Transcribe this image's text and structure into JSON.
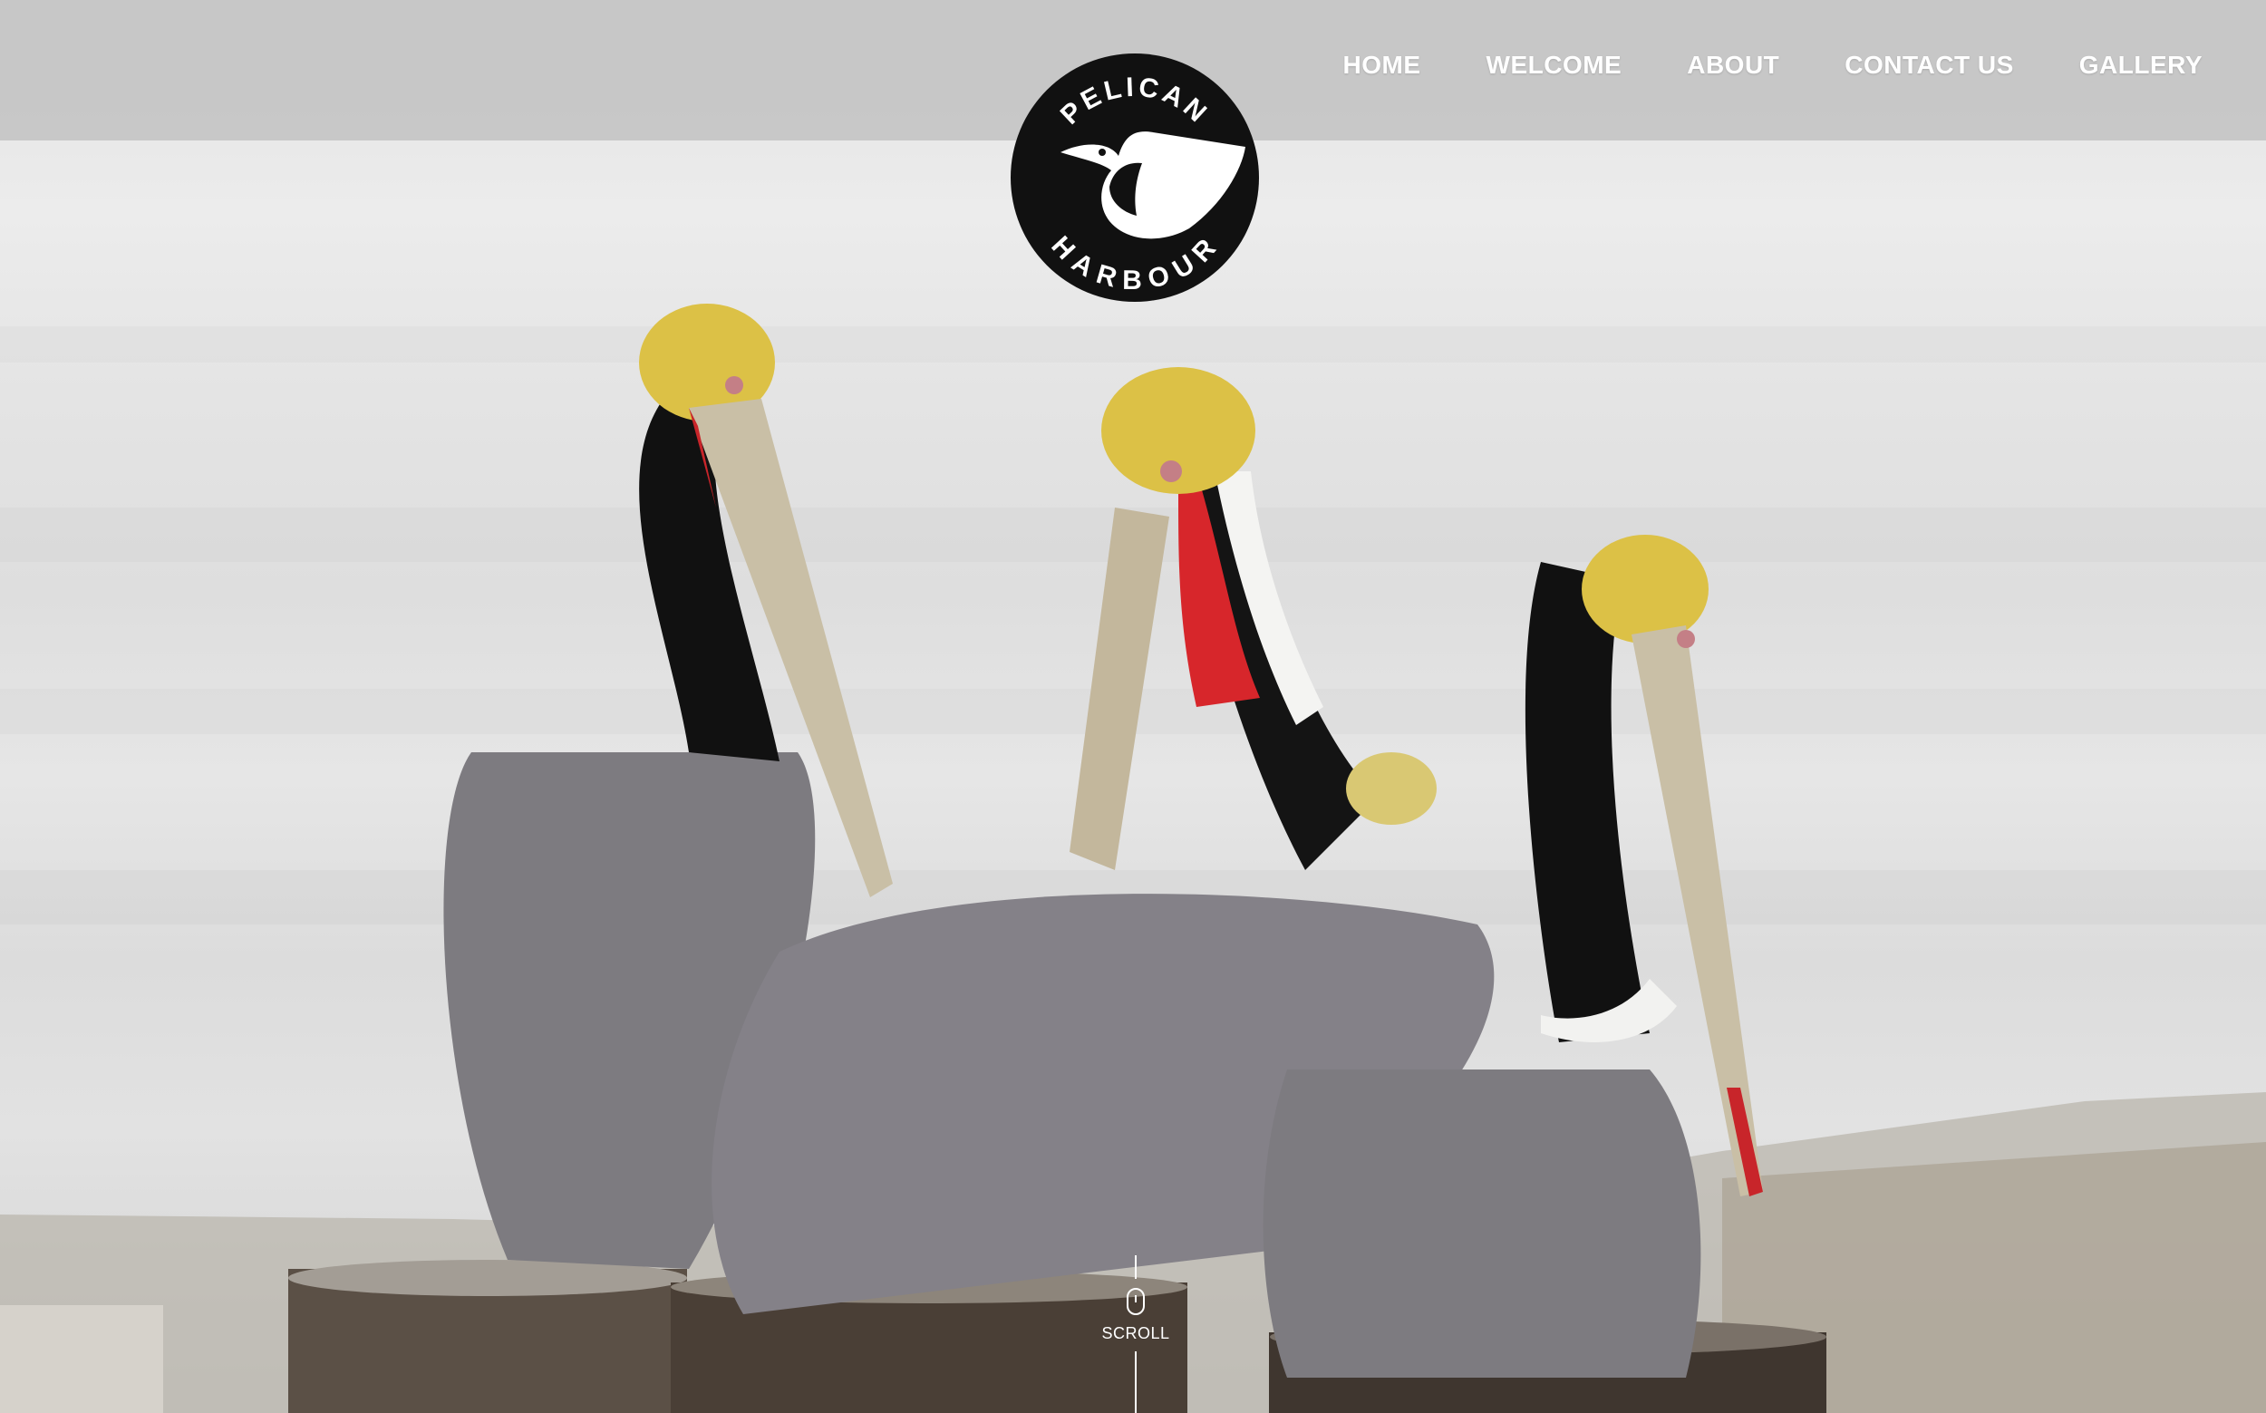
{
  "brand": {
    "logo_top": "PELICAN",
    "logo_bottom": "HARBOUR"
  },
  "nav": {
    "items": [
      {
        "label": "HOME"
      },
      {
        "label": "WELCOME"
      },
      {
        "label": "ABOUT"
      },
      {
        "label": "CONTACT US"
      },
      {
        "label": "GALLERY"
      }
    ]
  },
  "hero": {
    "scroll_label": "SCROLL"
  },
  "icons": [
    "pelican-logo-icon",
    "mouse-icon"
  ],
  "colors": {
    "header_bg": "#c4c4c4",
    "nav_text": "#ffffff",
    "logo_bg": "#111111"
  }
}
